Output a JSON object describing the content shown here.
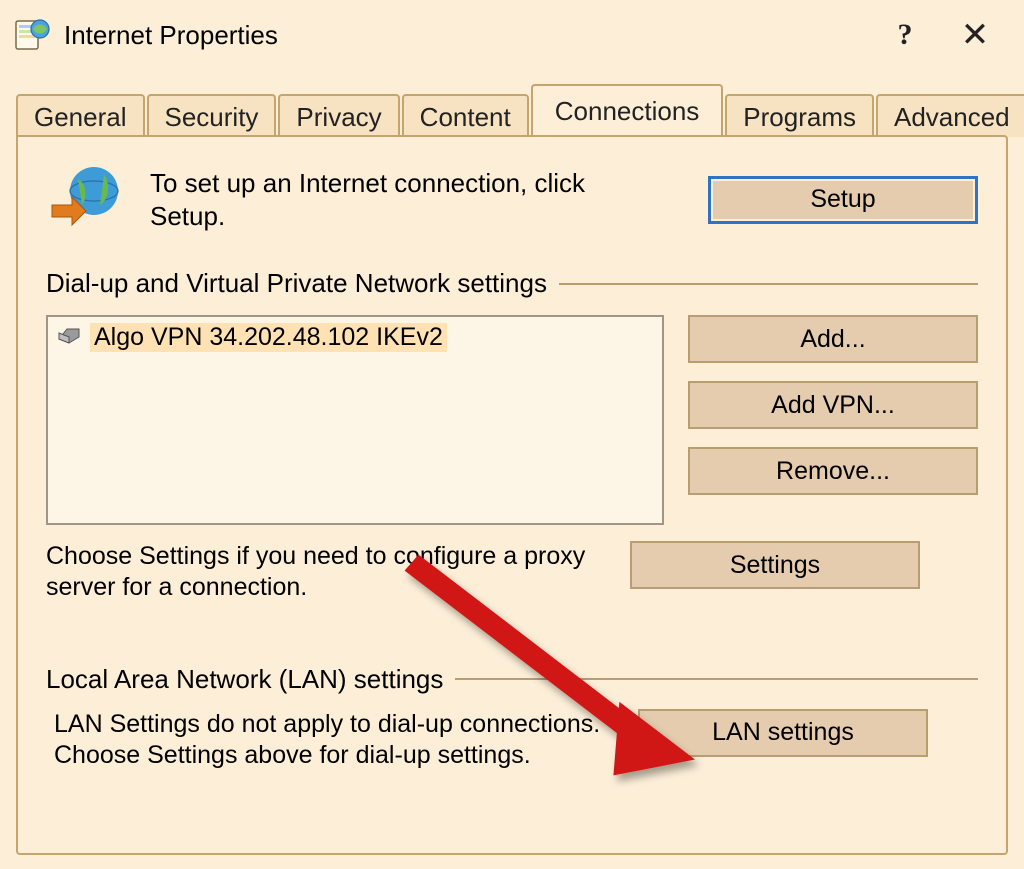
{
  "window": {
    "title": "Internet Properties"
  },
  "tabs": [
    {
      "label": "General"
    },
    {
      "label": "Security"
    },
    {
      "label": "Privacy"
    },
    {
      "label": "Content"
    },
    {
      "label": "Connections",
      "active": true
    },
    {
      "label": "Programs"
    },
    {
      "label": "Advanced"
    }
  ],
  "connections": {
    "setup_text": "To set up an Internet connection, click Setup.",
    "setup_button": "Setup",
    "dialup_group_title": "Dial-up and Virtual Private Network settings",
    "conn_items": [
      {
        "label": "Algo VPN 34.202.48.102 IKEv2"
      }
    ],
    "add_button": "Add...",
    "add_vpn_button": "Add VPN...",
    "remove_button": "Remove...",
    "proxy_text": "Choose Settings if you need to configure a proxy server for a connection.",
    "settings_button": "Settings",
    "lan_group_title": "Local Area Network (LAN) settings",
    "lan_text": "LAN Settings do not apply to dial-up connections. Choose Settings above for dial-up settings.",
    "lan_button": "LAN settings"
  }
}
